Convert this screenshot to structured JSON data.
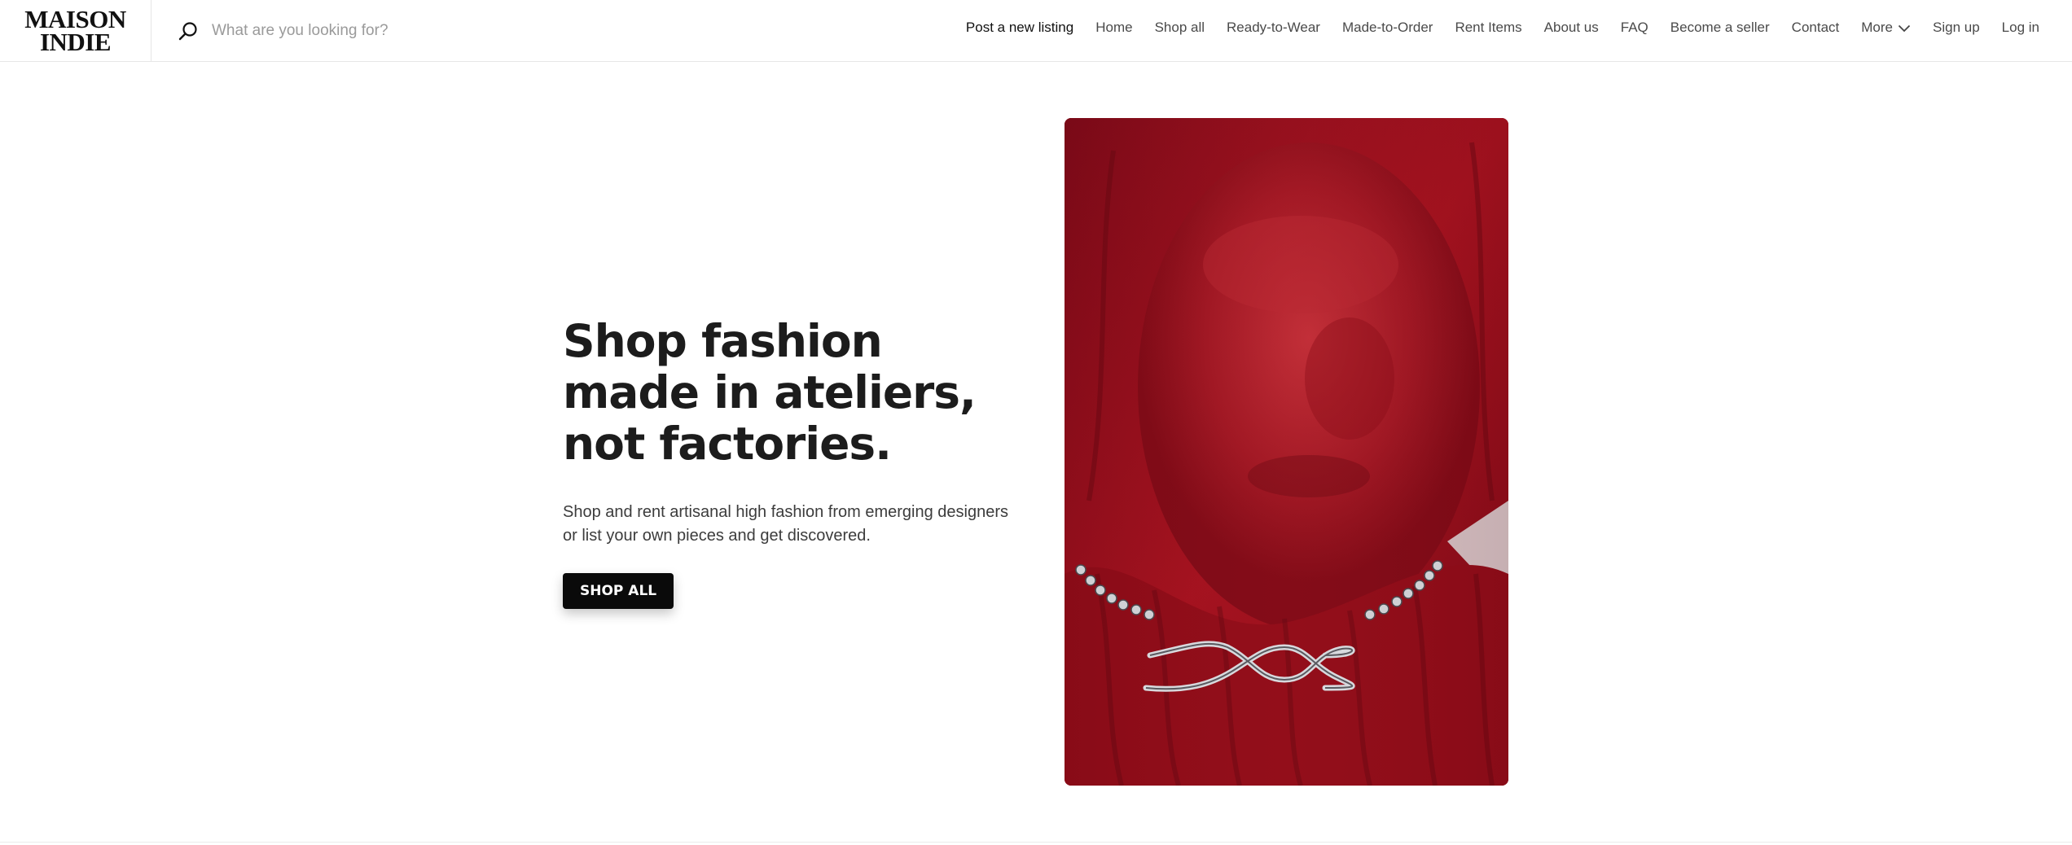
{
  "brand": {
    "logo_line1": "MAISON",
    "logo_line2": "INDIE"
  },
  "search": {
    "placeholder": "What are you looking for?",
    "icon": "search-icon"
  },
  "nav": {
    "items": [
      "Post a new listing",
      "Home",
      "Shop all",
      "Ready-to-Wear",
      "Made-to-Order",
      "Rent Items",
      "About us",
      "FAQ",
      "Become a seller",
      "Contact"
    ],
    "more_label": "More",
    "more_icon": "chevron-down-icon",
    "signup": "Sign up",
    "login": "Log in"
  },
  "hero": {
    "headline_line1": "Shop fashion",
    "headline_line2": "made in ateliers,",
    "headline_line3": "not factories.",
    "subtext": "Shop and rent artisanal high fashion from emerging designers or list your own pieces and get discovered.",
    "cta_label": "SHOP ALL",
    "image": "hero-photo-red-draped-fabric-over-face-with-silver-chain"
  },
  "colors": {
    "background": "#ffffff",
    "text": "#1c1c1c",
    "cta_background": "#0a0a0a",
    "cta_text": "#ffffff",
    "image_red": "#9c0f1f"
  }
}
